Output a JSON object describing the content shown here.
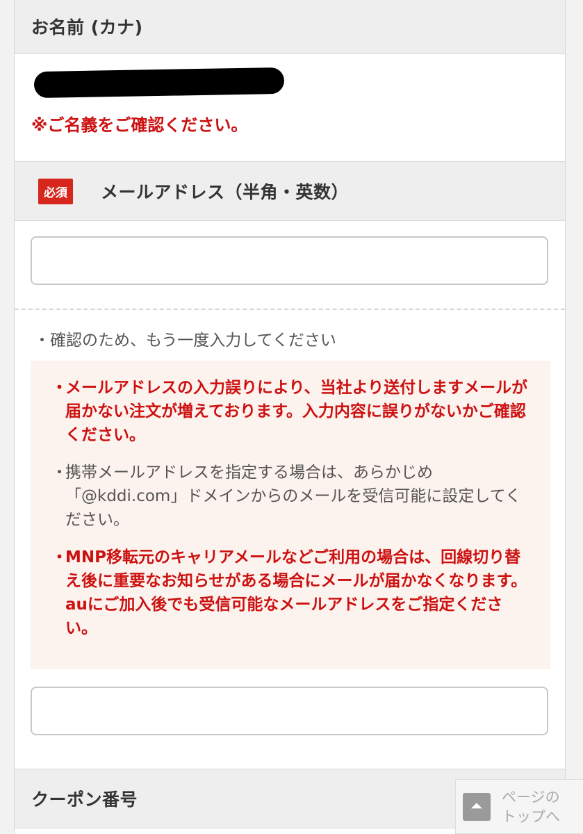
{
  "kana_section": {
    "title": "お名前 (カナ)",
    "note": "※ご名義をご確認ください。"
  },
  "email_section": {
    "required_badge": "必須",
    "title": "メールアドレス（半角・英数）",
    "confirm_hint": "・確認のため、もう一度入力してください",
    "notices": [
      {
        "bullet": "・",
        "text": "メールアドレスの入力誤りにより、当社より送付しますメールが届かない注文が増えております。入力内容に誤りがないかご確認ください。"
      },
      {
        "bullet": "・",
        "text": "携帯メールアドレスを指定する場合は、あらかじめ「@kddi.com」ドメインからのメールを受信可能に設定してください。"
      },
      {
        "bullet": "・",
        "text": "MNP移転元のキャリアメールなどご利用の場合は、回線切り替え後に重要なお知らせがある場合にメールが届かなくなります。auにご加入後でも受信可能なメールアドレスをご指定ください。"
      }
    ],
    "email_value": "",
    "email_confirm_value": ""
  },
  "coupon_section": {
    "title": "クーポン番号"
  },
  "page_top": {
    "arrow": "⏶",
    "label": "ページのトップへ"
  },
  "colors": {
    "accent_red": "#cc1111",
    "badge_red": "#d7261c",
    "notice_bg": "#fdf3ee"
  }
}
